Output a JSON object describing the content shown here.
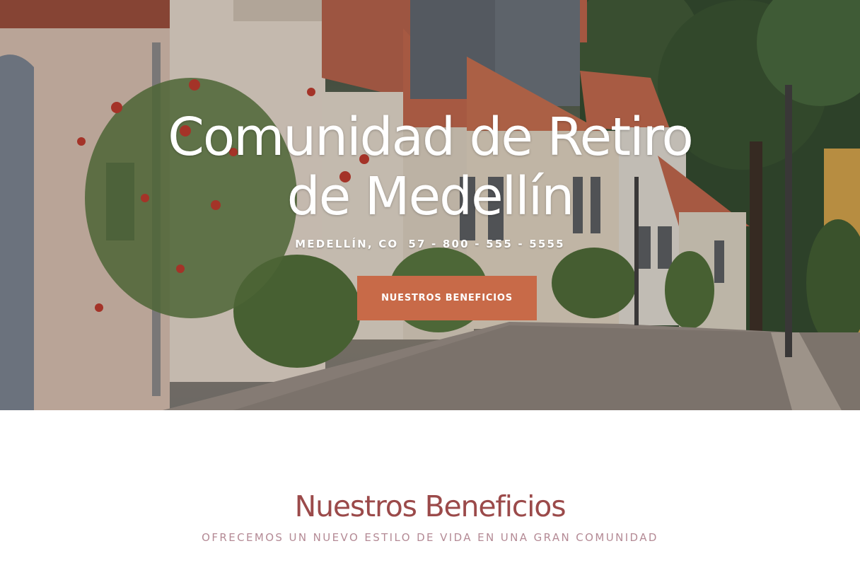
{
  "hero": {
    "title_line1": "Comunidad de Retiro",
    "title_line2": "de Medellín",
    "location": "MEDELLÍN, CO",
    "phone": "57 - 800 - 555 - 5555",
    "cta_label": "NUESTROS BENEFICIOS"
  },
  "benefits": {
    "title": "Nuestros Beneficios",
    "subtitle": "OFRECEMOS UN NUEVO ESTILO DE VIDA EN UNA GRAN COMUNIDAD"
  },
  "colors": {
    "accent": "#c86a48",
    "heading": "#9b4a4a",
    "subheading": "#b48a95"
  },
  "icons": [
    "hero-background-photo",
    "section-divider-notch"
  ]
}
